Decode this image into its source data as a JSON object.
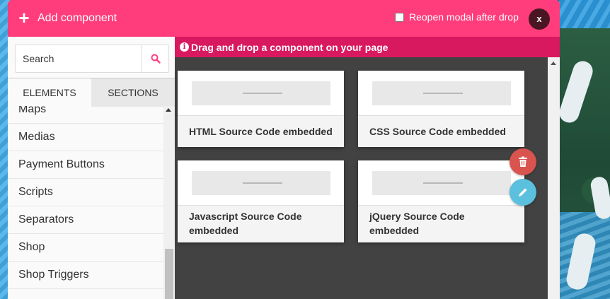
{
  "modal": {
    "title": "Add component",
    "add_icon": "plus-icon",
    "reopen_label": "Reopen modal after drop",
    "reopen_checked": false,
    "close_label": "x"
  },
  "search": {
    "placeholder": "Search",
    "value": ""
  },
  "tabs": [
    {
      "label": "ELEMENTS",
      "active": true
    },
    {
      "label": "SECTIONS",
      "active": false
    }
  ],
  "categories": [
    "Maps",
    "Medias",
    "Payment Buttons",
    "Scripts",
    "Separators",
    "Shop",
    "Shop Triggers"
  ],
  "info": {
    "icon": "info-icon",
    "text": "Drag and drop a component on your page"
  },
  "components": [
    {
      "title": "HTML Source Code embedded"
    },
    {
      "title": "CSS Source Code embedded"
    },
    {
      "title": "Javascript Source Code embedded"
    },
    {
      "title": "jQuery Source Code embedded"
    }
  ],
  "actions": {
    "delete_icon": "trash-icon",
    "edit_icon": "pencil-icon"
  },
  "colors": {
    "header": "#ff3d7c",
    "info_bar": "#d9195f",
    "close_button": "#4a1624",
    "delete": "#d9534f",
    "edit": "#5bc0de",
    "grid_background": "#424242"
  }
}
